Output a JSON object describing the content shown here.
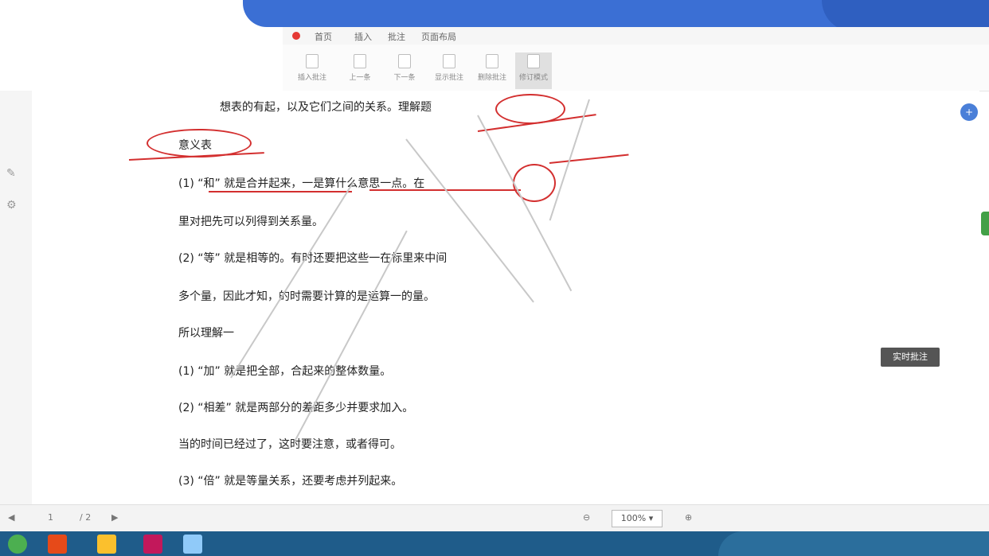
{
  "menu": {
    "items": [
      "首页",
      "插入",
      "批注",
      "页面布局"
    ]
  },
  "ribbon": {
    "buttons": [
      {
        "label": "插入批注",
        "active": false
      },
      {
        "label": "上一条",
        "active": false
      },
      {
        "label": "下一条",
        "active": false
      },
      {
        "label": "显示批注",
        "active": false
      },
      {
        "label": "删除批注",
        "active": false
      },
      {
        "label": "修订模式",
        "active": true
      }
    ]
  },
  "document": {
    "lines": [
      "想表的有起，以及它们之间的关系。理解题",
      "意义表",
      "(1) “和” 就是合并起来，一是算什么意思一点。在",
      "里对把先可以列得到关系量。",
      "(2) “等” 就是相等的。有时还要把这些一在标里来中间",
      "多个量，因此才知，的时需要计算的是运算一的量。",
      "所以理解一",
      "(1) “加” 就是把全部，合起来的整体数量。",
      "(2) “相差” 就是两部分的差距多少并要求加入。",
      "当的时间已经过了，这时要注意，或者得可。",
      "(3) “倍” 就是等量关系，还要考虑并列起来。"
    ]
  },
  "float_button": {
    "label": "+"
  },
  "side_tag": {
    "label": "实时批注"
  },
  "status": {
    "page": "1",
    "total": "/ 2",
    "zoom": "100% ▾"
  },
  "colors": {
    "annotation": "#d32f2f",
    "banner": "#3b6fd4",
    "taskbar": "#1f5c8a"
  }
}
